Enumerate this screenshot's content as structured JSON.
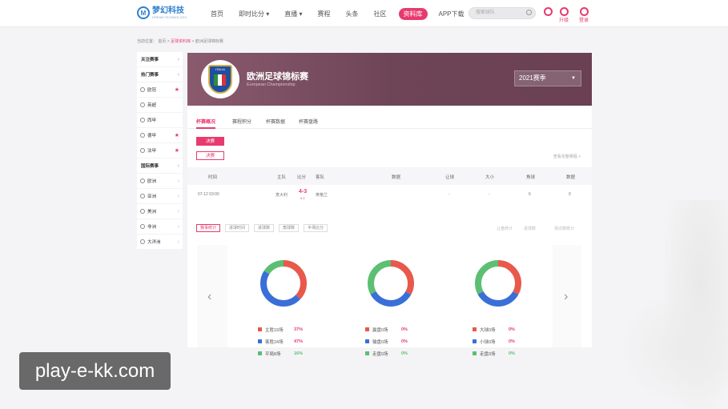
{
  "header": {
    "logo_name": "梦幻科技",
    "logo_sub": "DREAM TECHNOLOGY",
    "nav": [
      "首页",
      "即时比分 ▾",
      "直播 ▾",
      "赛程",
      "头条",
      "社区",
      "资料库",
      "APP下载"
    ],
    "search_placeholder": "搜索球队",
    "upgrade_label": "升级",
    "login_label": "登录"
  },
  "breadcrumb": {
    "prefix": "当前位置：",
    "home": "首页",
    "sep": " > ",
    "db": "足球资料库",
    "current": "欧洲足球锦标赛"
  },
  "sidebar": {
    "items": [
      {
        "label": "关注赛事",
        "kind": "head"
      },
      {
        "label": "热门赛事",
        "kind": "head"
      },
      {
        "label": "欧冠",
        "kind": "star"
      },
      {
        "label": "英超",
        "kind": "plain"
      },
      {
        "label": "西甲",
        "kind": "plain"
      },
      {
        "label": "德甲",
        "kind": "star"
      },
      {
        "label": "法甲",
        "kind": "star"
      },
      {
        "label": "国际赛事",
        "kind": "head"
      },
      {
        "label": "欧洲",
        "kind": "arrow"
      },
      {
        "label": "亚洲",
        "kind": "arrow"
      },
      {
        "label": "美洲",
        "kind": "arrow"
      },
      {
        "label": "非洲",
        "kind": "arrow"
      },
      {
        "label": "大洋洲",
        "kind": "arrow"
      }
    ]
  },
  "banner": {
    "title": "欧洲足球锦标赛",
    "subtitle": "European Championship",
    "season": "2021赛季",
    "badge_text": "ITALIA"
  },
  "tabs": [
    "杯赛概况",
    "赛程积分",
    "杯赛数据",
    "杯赛盘路"
  ],
  "buttons": {
    "primary": "决赛",
    "secondary": "决赛"
  },
  "link_right": "查看完整赛程 >",
  "table": {
    "headers": [
      "时间",
      "主队",
      "比分",
      "客队",
      "数据",
      "让球",
      "大小",
      "角球",
      "数据"
    ],
    "row": {
      "time": "07-12 03:00",
      "home": "意大利",
      "score": "4-3",
      "score_sub": "0-1",
      "away": "英格兰",
      "handicap": "-",
      "ou": "-",
      "corner": "6",
      "data": "0"
    }
  },
  "stat_tabs": [
    "赛事统计",
    "进球时间",
    "进球数",
    "角球数",
    "半场比分"
  ],
  "stat_right": [
    "让盘统计",
    "进球数",
    "场次数统计"
  ],
  "charts": [
    {
      "legend": [
        {
          "label": "主胜19场",
          "pct": "37%",
          "color": "#e8594b"
        },
        {
          "label": "客胜24场",
          "pct": "47%",
          "color": "#3a6fd8"
        },
        {
          "label": "平局8场",
          "pct": "16%",
          "color": "#5cbf72"
        }
      ],
      "values": [
        37,
        47,
        16
      ]
    },
    {
      "legend": [
        {
          "label": "赢盘0场",
          "pct": "0%",
          "color": "#e8594b"
        },
        {
          "label": "输盘0场",
          "pct": "0%",
          "color": "#3a6fd8"
        },
        {
          "label": "走盘0场",
          "pct": "0%",
          "color": "#5cbf72"
        }
      ],
      "values": [
        33,
        34,
        33
      ]
    },
    {
      "legend": [
        {
          "label": "大球0场",
          "pct": "0%",
          "color": "#e8594b"
        },
        {
          "label": "小球0场",
          "pct": "0%",
          "color": "#3a6fd8"
        },
        {
          "label": "走盘0场",
          "pct": "0%",
          "color": "#5cbf72"
        }
      ],
      "values": [
        33,
        34,
        33
      ]
    }
  ],
  "watermark": "play-e-kk.com"
}
